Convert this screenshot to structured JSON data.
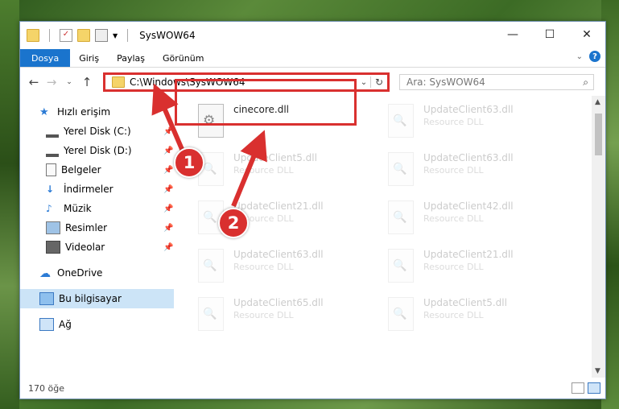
{
  "window": {
    "title": "SysWOW64"
  },
  "ribbon": {
    "tabs": [
      "Dosya",
      "Giriş",
      "Paylaş",
      "Görünüm"
    ],
    "active_tab": "Dosya"
  },
  "address": {
    "path": "C:\\Windows\\SysWOW64"
  },
  "search": {
    "placeholder": "Ara: SysWOW64"
  },
  "sidebar": {
    "items": [
      {
        "label": "Hızlı erişim",
        "icon": "star-icon"
      },
      {
        "label": "Yerel Disk (C:)",
        "icon": "drive-icon"
      },
      {
        "label": "Yerel Disk (D:)",
        "icon": "drive-icon"
      },
      {
        "label": "Belgeler",
        "icon": "documents-icon"
      },
      {
        "label": "İndirmeler",
        "icon": "download-icon"
      },
      {
        "label": "Müzik",
        "icon": "music-icon"
      },
      {
        "label": "Resimler",
        "icon": "pictures-icon"
      },
      {
        "label": "Videolar",
        "icon": "video-icon"
      },
      {
        "label": "OneDrive",
        "icon": "cloud-icon"
      },
      {
        "label": "Bu bilgisayar",
        "icon": "computer-icon"
      },
      {
        "label": "Ağ",
        "icon": "network-icon"
      }
    ]
  },
  "files": {
    "selected": {
      "name": "cinecore.dll",
      "type": ""
    },
    "items": [
      {
        "name": "UpdateClient63.dll",
        "type": "Resource DLL"
      },
      {
        "name": "UpdateClient5.dll",
        "type": "Resource DLL"
      },
      {
        "name": "UpdateClient63.dll",
        "type": "Resource DLL"
      },
      {
        "name": "UpdateClient21.dll",
        "type": "Resource DLL"
      },
      {
        "name": "UpdateClient42.dll",
        "type": "Resource DLL"
      },
      {
        "name": "UpdateClient63.dll",
        "type": "Resource DLL"
      },
      {
        "name": "UpdateClient21.dll",
        "type": "Resource DLL"
      },
      {
        "name": "UpdateClient65.dll",
        "type": "Resource DLL"
      },
      {
        "name": "UpdateClient5.dll",
        "type": "Resource DLL"
      }
    ]
  },
  "status": {
    "count": "170 öğe"
  },
  "annotations": {
    "step1": "1",
    "step2": "2",
    "color": "#d9302f"
  }
}
